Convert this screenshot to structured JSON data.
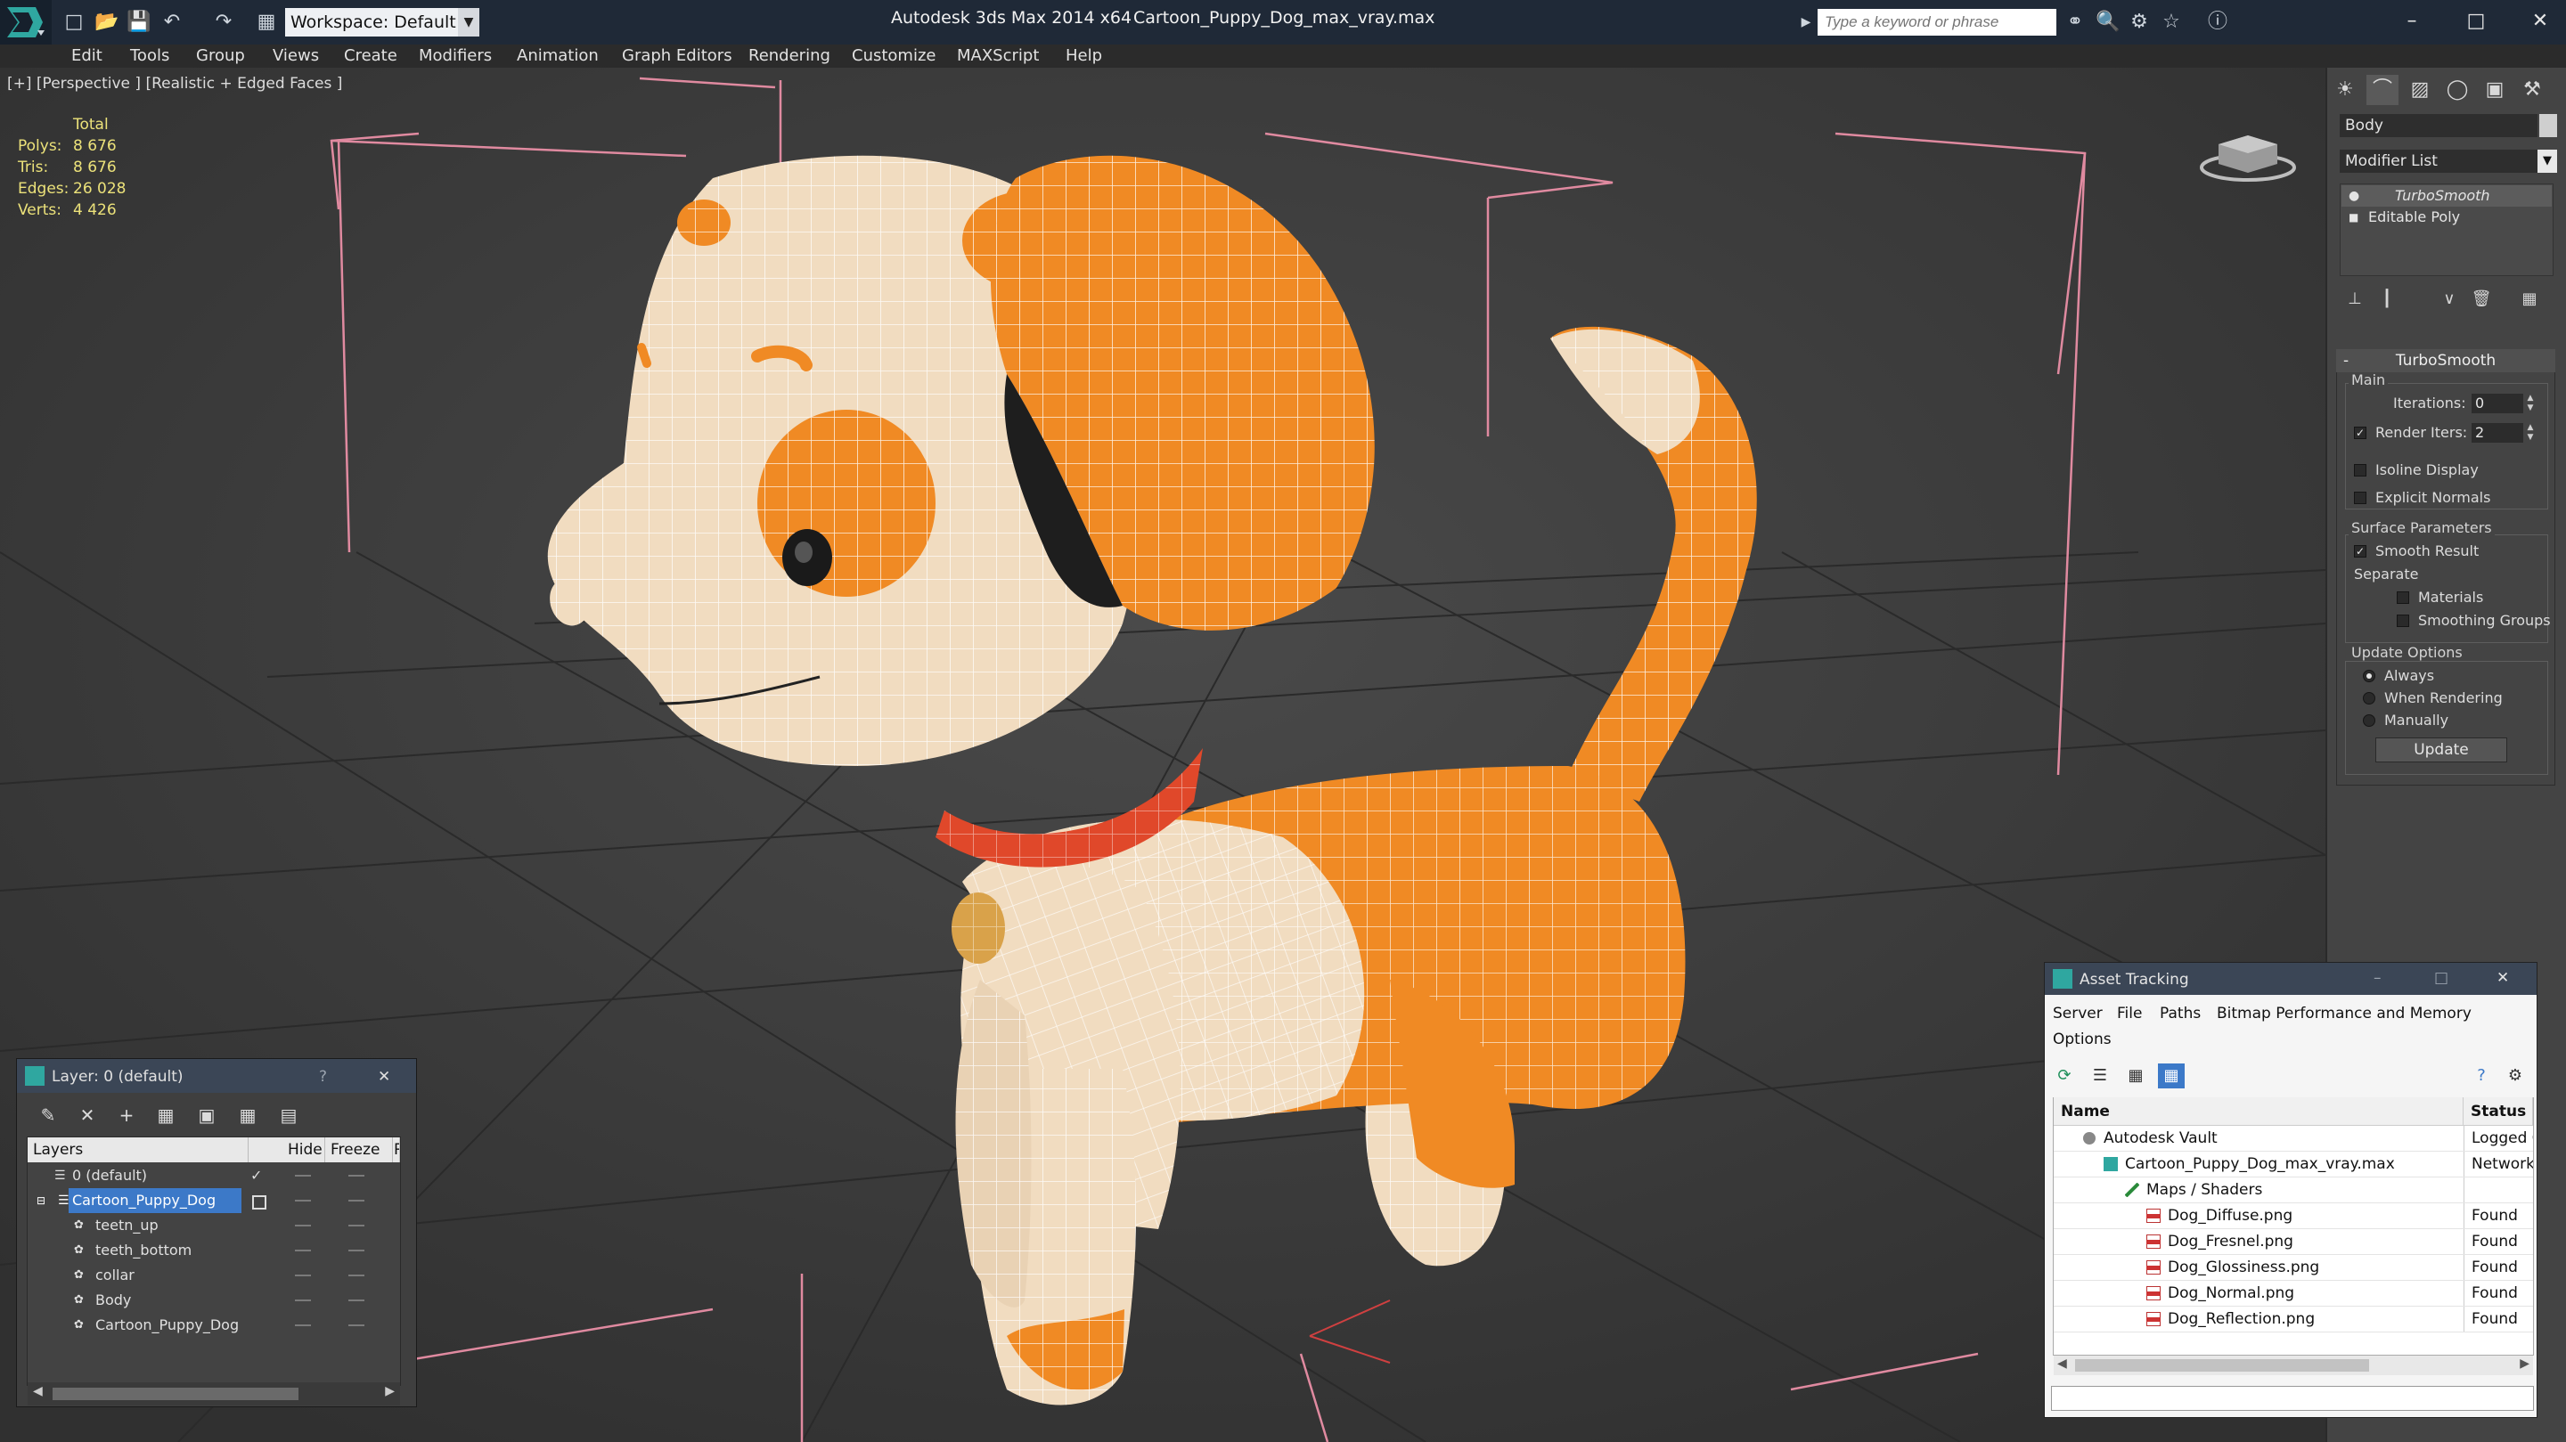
{
  "titlebar": {
    "workspace": "Workspace: Default",
    "app_title": "Autodesk 3ds Max  2014 x64",
    "file_title": "Cartoon_Puppy_Dog_max_vray.max",
    "search_placeholder": "Type a keyword or phrase"
  },
  "menu": [
    "Edit",
    "Tools",
    "Group",
    "Views",
    "Create",
    "Modifiers",
    "Animation",
    "Graph Editors",
    "Rendering",
    "Customize",
    "MAXScript",
    "Help"
  ],
  "viewport": {
    "label": "[+] [Perspective ] [Realistic + Edged Faces ]",
    "stats_header": "Total",
    "stats": [
      {
        "label": "Polys:",
        "value": "8 676"
      },
      {
        "label": "Tris:",
        "value": "8 676"
      },
      {
        "label": "Edges:",
        "value": "26 028"
      },
      {
        "label": "Verts:",
        "value": "4 426"
      }
    ]
  },
  "command_panel": {
    "object_name": "Body",
    "modifier_list": "Modifier List",
    "stack": [
      "TurboSmooth",
      "Editable Poly"
    ],
    "rollout_title": "TurboSmooth",
    "main_label": "Main",
    "iterations_label": "Iterations:",
    "iterations_value": "0",
    "render_iters_label": "Render Iters:",
    "render_iters_value": "2",
    "isoline_label": "Isoline Display",
    "explicit_normals_label": "Explicit Normals",
    "surface_params_label": "Surface Parameters",
    "smooth_result_label": "Smooth Result",
    "separate_label": "Separate",
    "materials_label": "Materials",
    "smoothing_groups_label": "Smoothing Groups",
    "update_options_label": "Update Options",
    "always_label": "Always",
    "when_rendering_label": "When Rendering",
    "manually_label": "Manually",
    "update_button": "Update"
  },
  "layer_window": {
    "title": "Layer: 0 (default)",
    "help": "?",
    "columns": {
      "layers": "Layers",
      "hide": "Hide",
      "freeze": "Freeze",
      "render": "R"
    },
    "rows": [
      {
        "name": "0 (default)"
      },
      {
        "name": "Cartoon_Puppy_Dog"
      },
      {
        "name": "teetn_up"
      },
      {
        "name": "teeth_bottom"
      },
      {
        "name": "collar"
      },
      {
        "name": "Body"
      },
      {
        "name": "Cartoon_Puppy_Dog"
      }
    ]
  },
  "asset_window": {
    "title": "Asset Tracking",
    "menu": [
      "Server",
      "File",
      "Paths",
      "Bitmap Performance and Memory",
      "Options"
    ],
    "columns": {
      "name": "Name",
      "status": "Status"
    },
    "rows": [
      {
        "name": "Autodesk Vault",
        "status": "Logged O"
      },
      {
        "name": "Cartoon_Puppy_Dog_max_vray.max",
        "status": "Network"
      },
      {
        "name": "Maps / Shaders",
        "status": ""
      },
      {
        "name": "Dog_Diffuse.png",
        "status": "Found"
      },
      {
        "name": "Dog_Fresnel.png",
        "status": "Found"
      },
      {
        "name": "Dog_Glossiness.png",
        "status": "Found"
      },
      {
        "name": "Dog_Normal.png",
        "status": "Found"
      },
      {
        "name": "Dog_Reflection.png",
        "status": "Found"
      }
    ]
  },
  "colors": {
    "titlebar": "#1f2937",
    "viewport": "#3a3a3a",
    "stats_text": "#ece27a",
    "selection": "#3c79c8",
    "puppy_orange": "#f08a24",
    "puppy_cream": "#f1dcc0",
    "collar_red": "#e0482a"
  }
}
